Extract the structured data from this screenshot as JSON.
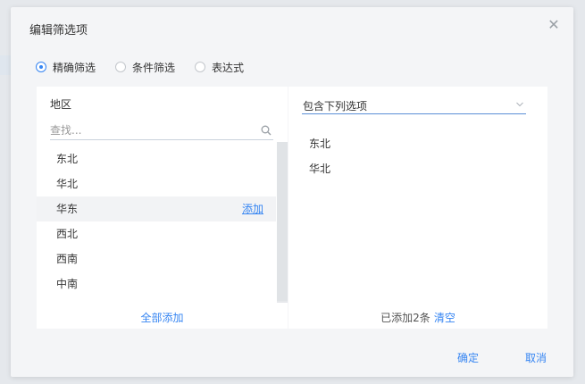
{
  "dialog": {
    "title": "编辑筛选项",
    "close_icon": "close-icon"
  },
  "filter_modes": [
    {
      "label": "精确筛选",
      "checked": true
    },
    {
      "label": "条件筛选",
      "checked": false
    },
    {
      "label": "表达式",
      "checked": false
    }
  ],
  "left_panel": {
    "field_name": "地区",
    "search": {
      "placeholder": "查找...",
      "value": ""
    },
    "items": [
      {
        "label": "东北",
        "hovered": false
      },
      {
        "label": "华北",
        "hovered": false
      },
      {
        "label": "华东",
        "hovered": true
      },
      {
        "label": "西北",
        "hovered": false
      },
      {
        "label": "西南",
        "hovered": false
      },
      {
        "label": "中南",
        "hovered": false
      }
    ],
    "add_link": "添加",
    "add_all": "全部添加"
  },
  "right_panel": {
    "mode_select": "包含下列选项",
    "selected_items": [
      "东北",
      "华北"
    ],
    "count_text": "已添加2条",
    "clear": "清空"
  },
  "footer": {
    "ok": "确定",
    "cancel": "取消"
  },
  "colors": {
    "accent": "#3685f2",
    "hover_row": "#f2f3f5"
  }
}
